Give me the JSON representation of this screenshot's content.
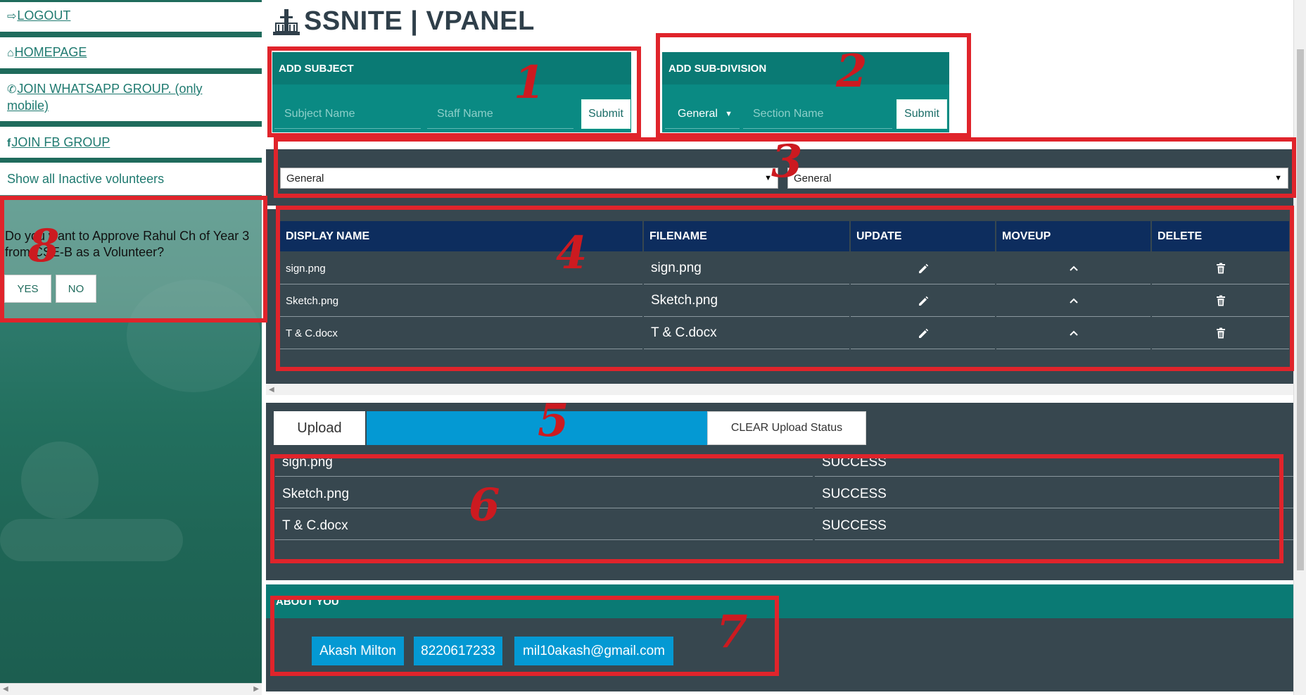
{
  "sidebar": {
    "links": [
      {
        "label": "LOGOUT",
        "icon": "logout-icon"
      },
      {
        "label": "HOMEPAGE",
        "icon": "home-icon"
      },
      {
        "label": "JOIN WHATSAPP GROUP. (only mobile)",
        "icon": "whatsapp-icon"
      },
      {
        "label": "JOIN FB GROUP",
        "icon": "facebook-icon"
      }
    ],
    "inactive_link": "Show all Inactive volunteers",
    "approve": {
      "question": "Do you want to Approve Rahul Ch of Year 3 from CSE-B as a Volunteer?",
      "yes_label": "YES",
      "no_label": "NO"
    }
  },
  "header": {
    "title": "SSNITE | VPANEL",
    "logo_icon": "tower-logo-icon"
  },
  "add_subject": {
    "title": "ADD SUBJECT",
    "subject_placeholder": "Subject Name",
    "staff_placeholder": "Staff Name",
    "submit_label": "Submit"
  },
  "add_subdivision": {
    "title": "ADD SUB-DIVISION",
    "select_value": "General",
    "section_placeholder": "Section Name",
    "submit_label": "Submit"
  },
  "filters": {
    "subject_value": "General",
    "subdivision_value": "General"
  },
  "files_table": {
    "columns": [
      "DISPLAY NAME",
      "FILENAME",
      "UPDATE",
      "MOVEUP",
      "DELETE"
    ],
    "rows": [
      {
        "display_name": "sign.png",
        "filename": "sign.png"
      },
      {
        "display_name": "Sketch.png",
        "filename": "Sketch.png"
      },
      {
        "display_name": "T & C.docx",
        "filename": "T & C.docx"
      }
    ],
    "update_icon": "pencil-icon",
    "moveup_icon": "chevron-up-icon",
    "delete_icon": "trash-icon"
  },
  "upload": {
    "upload_label": "Upload",
    "clear_label": "CLEAR Upload Status",
    "progress": 1.0,
    "status_rows": [
      {
        "file": "sign.png",
        "status": "SUCCESS"
      },
      {
        "file": "Sketch.png",
        "status": "SUCCESS"
      },
      {
        "file": "T & C.docx",
        "status": "SUCCESS"
      }
    ]
  },
  "about": {
    "title": "ABOUT YOU",
    "name": "Akash Milton",
    "phone": "8220617233",
    "email": "mil10akash@gmail.com"
  },
  "annotations": [
    "1",
    "2",
    "3",
    "4",
    "5",
    "6",
    "7",
    "8"
  ],
  "colors": {
    "accent_teal": "#0a7a74",
    "panel_dark": "#37474f",
    "table_header": "#0d2d5e",
    "progress_blue": "#0499d3",
    "annotation_red": "#e0242b"
  }
}
